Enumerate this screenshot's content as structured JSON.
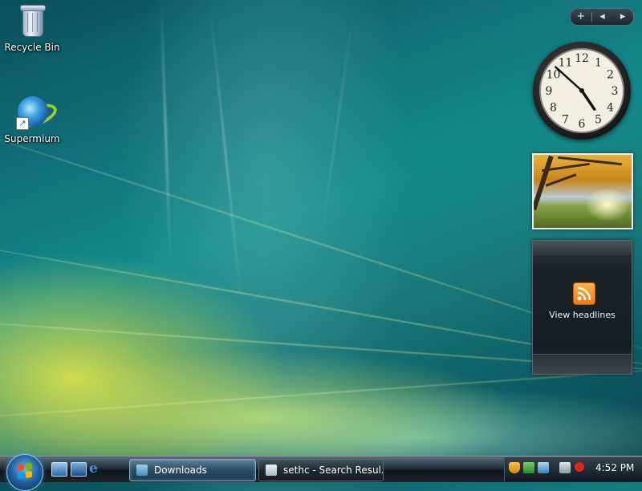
{
  "desktop": {
    "icons": [
      {
        "label": "Recycle Bin",
        "icon": "recycle-bin-icon"
      },
      {
        "label": "Supermium",
        "icon": "supermium-icon"
      }
    ]
  },
  "sidebar": {
    "controls": {
      "add": "+",
      "prev": "◂",
      "next": "▸"
    },
    "clock": {
      "numerals": [
        "12",
        "1",
        "2",
        "3",
        "4",
        "5",
        "6",
        "7",
        "8",
        "9",
        "10",
        "11"
      ],
      "time": "4:52"
    },
    "feed": {
      "caption": "View headlines",
      "icon": "rss-icon"
    },
    "slideshow": {
      "icon": "autumn-tree-photo"
    }
  },
  "taskbar": {
    "start": {
      "icon": "windows-start-orb"
    },
    "quick_launch": [
      "show-desktop-icon",
      "switch-windows-icon",
      "internet-explorer-icon"
    ],
    "buttons": [
      {
        "label": "Downloads",
        "icon": "folder-icon",
        "active": true
      },
      {
        "label": "sethc - Search Resul...",
        "icon": "browser-icon",
        "active": false
      }
    ],
    "tray": {
      "icons": [
        "security-shield-icon",
        "windows-defender-icon",
        "network-icon",
        "volume-muted-icon"
      ],
      "time": "4:52 PM"
    }
  },
  "colors": {
    "accent": "#1a7c7c",
    "taskbar": "#0e171d",
    "rss": "#f07a12"
  }
}
